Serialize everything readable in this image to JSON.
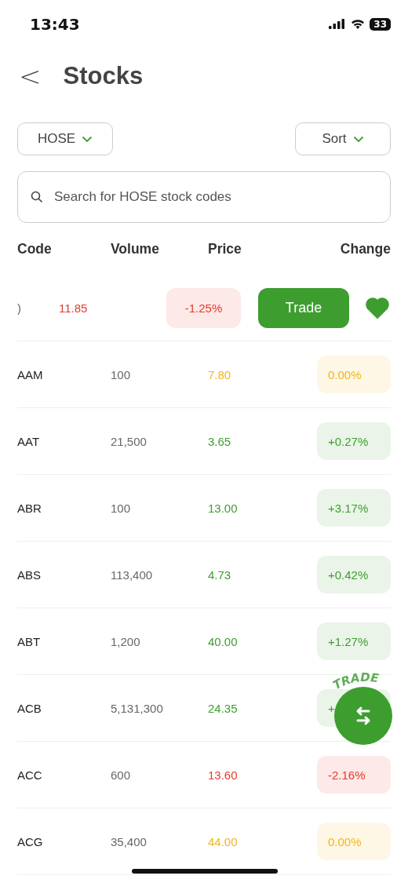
{
  "status_bar": {
    "time": "13:43",
    "battery": "33"
  },
  "header": {
    "back": "<",
    "title": "Stocks"
  },
  "filters": {
    "exchange": "HOSE",
    "sort": "Sort"
  },
  "search": {
    "placeholder": "Search for HOSE stock codes"
  },
  "columns": [
    "Code",
    "Volume",
    "Price",
    "Change"
  ],
  "swiped_row": {
    "code": ")",
    "price": "11.85",
    "change": "-1.25%",
    "color": "#e53a2b",
    "trade": "Trade",
    "favorite": true
  },
  "rows": [
    {
      "code": "AAM",
      "volume": "100",
      "price": "7.80",
      "change": "0.00%",
      "color": "#f2b51b"
    },
    {
      "code": "AAT",
      "volume": "21,500",
      "price": "3.65",
      "change": "+0.27%",
      "color": "#3d9e2f"
    },
    {
      "code": "ABR",
      "volume": "100",
      "price": "13.00",
      "change": "+3.17%",
      "color": "#3d9e2f"
    },
    {
      "code": "ABS",
      "volume": "113,400",
      "price": "4.73",
      "change": "+0.42%",
      "color": "#3d9e2f"
    },
    {
      "code": "ABT",
      "volume": "1,200",
      "price": "40.00",
      "change": "+1.27%",
      "color": "#3d9e2f"
    },
    {
      "code": "ACB",
      "volume": "5,131,300",
      "price": "24.35",
      "change": "+",
      "color": "#3d9e2f"
    },
    {
      "code": "ACC",
      "volume": "600",
      "price": "13.60",
      "change": "-2.16%",
      "color": "#e53a2b"
    },
    {
      "code": "ACG",
      "volume": "35,400",
      "price": "44.00",
      "change": "0.00%",
      "color": "#f2b51b"
    }
  ],
  "fab": {
    "label": "TRADE"
  }
}
